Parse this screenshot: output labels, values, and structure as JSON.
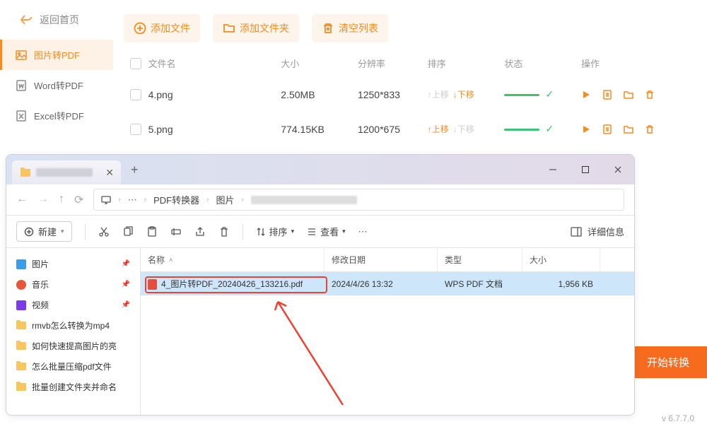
{
  "sidebar": {
    "back": "返回首页",
    "items": [
      {
        "label": "图片转PDF",
        "active": true
      },
      {
        "label": "Word转PDF",
        "active": false
      },
      {
        "label": "Excel转PDF",
        "active": false
      }
    ]
  },
  "toolbar": {
    "add_file": "添加文件",
    "add_folder": "添加文件夹",
    "clear_list": "清空列表"
  },
  "table": {
    "headers": {
      "name": "文件名",
      "size": "大小",
      "resolution": "分辨率",
      "sort": "排序",
      "status": "状态",
      "ops": "操作"
    },
    "sort_up": "上移",
    "sort_down": "下移",
    "rows": [
      {
        "name": "4.png",
        "size": "2.50MB",
        "res": "1250*833",
        "up_active": false,
        "down_active": true
      },
      {
        "name": "5.png",
        "size": "774.15KB",
        "res": "1200*675",
        "up_active": true,
        "down_active": false
      }
    ]
  },
  "start_convert": "开始转换",
  "version": "v 6.7.7.0",
  "explorer": {
    "breadcrumb": [
      "PDF转换器",
      "图片"
    ],
    "new_btn": "新建",
    "sort_btn": "排序",
    "view_btn": "查看",
    "details_btn": "详细信息",
    "side": [
      {
        "type": "special",
        "icon": "image",
        "label": "图片",
        "pinned": true
      },
      {
        "type": "special",
        "icon": "music",
        "label": "音乐",
        "pinned": true
      },
      {
        "type": "special",
        "icon": "video",
        "label": "视频",
        "pinned": true
      },
      {
        "type": "folder",
        "label": "rmvb怎么转换为mp4"
      },
      {
        "type": "folder",
        "label": "如何快速提高图片的亮"
      },
      {
        "type": "folder",
        "label": "怎么批量压缩pdf文件"
      },
      {
        "type": "folder",
        "label": "批量创建文件夹并命名"
      }
    ],
    "cols": {
      "name": "名称",
      "date": "修改日期",
      "type": "类型",
      "size": "大小"
    },
    "files": [
      {
        "name": "4_图片转PDF_20240426_133216.pdf",
        "date": "2024/4/26 13:32",
        "type": "WPS PDF 文档",
        "size": "1,956 KB",
        "selected": true
      }
    ]
  }
}
